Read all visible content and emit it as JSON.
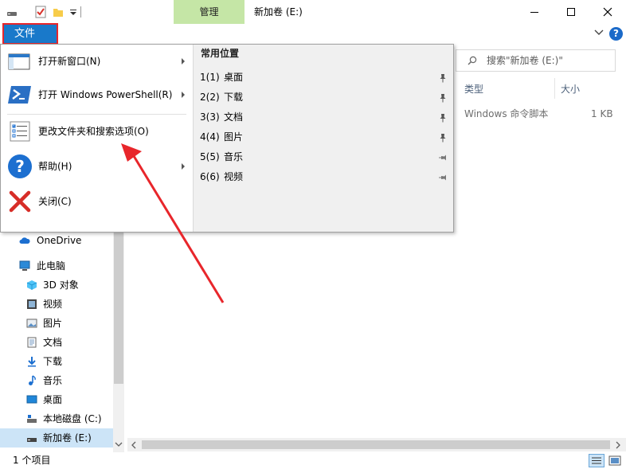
{
  "titlebar": {
    "manage_tab": "管理",
    "window_title": "新加卷 (E:)"
  },
  "ribbon": {
    "file_tab": "文件",
    "help_symbol": "?"
  },
  "search": {
    "placeholder": "搜索\"新加卷 (E:)\""
  },
  "file_list": {
    "columns": [
      "类型",
      "大小"
    ],
    "rows": [
      {
        "type": "Windows 命令脚本",
        "size": "1 KB"
      }
    ]
  },
  "file_menu": {
    "items": [
      {
        "label": "打开新窗口(N)",
        "icon": "new-window-icon",
        "has_submenu": true
      },
      {
        "label": "打开 Windows PowerShell(R)",
        "icon": "powershell-icon",
        "has_submenu": true
      },
      {
        "label": "更改文件夹和搜索选项(O)",
        "icon": "folder-options-icon",
        "has_submenu": false
      },
      {
        "label": "帮助(H)",
        "icon": "help-icon",
        "has_submenu": true
      },
      {
        "label": "关闭(C)",
        "icon": "close-icon",
        "has_submenu": false
      }
    ],
    "places_title": "常用位置",
    "places": [
      {
        "num": "1(1)",
        "name": "桌面",
        "pinned": true
      },
      {
        "num": "2(2)",
        "name": "下载",
        "pinned": true
      },
      {
        "num": "3(3)",
        "name": "文档",
        "pinned": true
      },
      {
        "num": "4(4)",
        "name": "图片",
        "pinned": true
      },
      {
        "num": "5(5)",
        "name": "音乐",
        "pinned": false
      },
      {
        "num": "6(6)",
        "name": "视频",
        "pinned": false
      }
    ]
  },
  "nav": {
    "items": [
      {
        "label": "OneDrive",
        "icon": "cloud-icon",
        "indent": 0,
        "selected": false
      },
      {
        "label": "此电脑",
        "icon": "computer-icon",
        "indent": 0,
        "selected": false
      },
      {
        "label": "3D 对象",
        "icon": "3d-objects-icon",
        "indent": 1,
        "selected": false
      },
      {
        "label": "视频",
        "icon": "video-icon",
        "indent": 1,
        "selected": false
      },
      {
        "label": "图片",
        "icon": "pictures-icon",
        "indent": 1,
        "selected": false
      },
      {
        "label": "文档",
        "icon": "documents-icon",
        "indent": 1,
        "selected": false
      },
      {
        "label": "下载",
        "icon": "download-icon",
        "indent": 1,
        "selected": false
      },
      {
        "label": "音乐",
        "icon": "music-icon",
        "indent": 1,
        "selected": false
      },
      {
        "label": "桌面",
        "icon": "desktop-icon",
        "indent": 1,
        "selected": false
      },
      {
        "label": "本地磁盘 (C:)",
        "icon": "drive-icon",
        "indent": 1,
        "selected": false
      },
      {
        "label": "新加卷 (E:)",
        "icon": "drive-icon",
        "indent": 1,
        "selected": true
      }
    ]
  },
  "status": {
    "item_count": "1 个项目"
  },
  "colors": {
    "file_tab_blue": "#1979ca",
    "manage_tab_green": "#c5e6a6",
    "highlight_red": "#e8262b",
    "selection_blue": "#cce4f7"
  }
}
